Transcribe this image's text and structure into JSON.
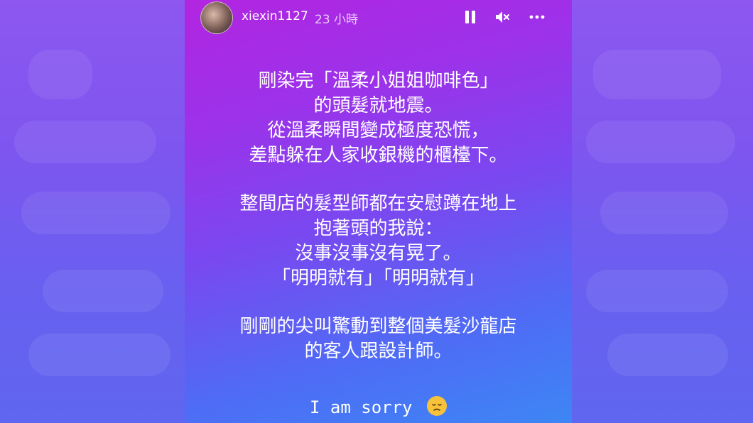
{
  "story": {
    "username": "xiexin1127",
    "time": "23 小時",
    "paragraphs": [
      [
        "剛染完「溫柔小姐姐咖啡色」",
        "的頭髮就地震。",
        "從溫柔瞬間變成極度恐慌，",
        "差點躲在人家收銀機的櫃檯下。"
      ],
      [
        "整間店的髮型師都在安慰蹲在地上",
        "抱著頭的我說：",
        "沒事沒事沒有晃了。",
        "「明明就有」「明明就有」"
      ],
      [
        "剛剛的尖叫驚動到整個美髮沙龍店",
        "的客人跟設計師。"
      ]
    ],
    "sorry": "I am sorry",
    "emoji": "disappointed-face-emoji"
  },
  "icons": {
    "pause": "pause-icon",
    "mute": "mute-icon",
    "more": "more-icon"
  },
  "colors": {
    "gradient_top": "#b225e0",
    "gradient_bottom": "#3d86f5",
    "text": "#ffffff"
  }
}
